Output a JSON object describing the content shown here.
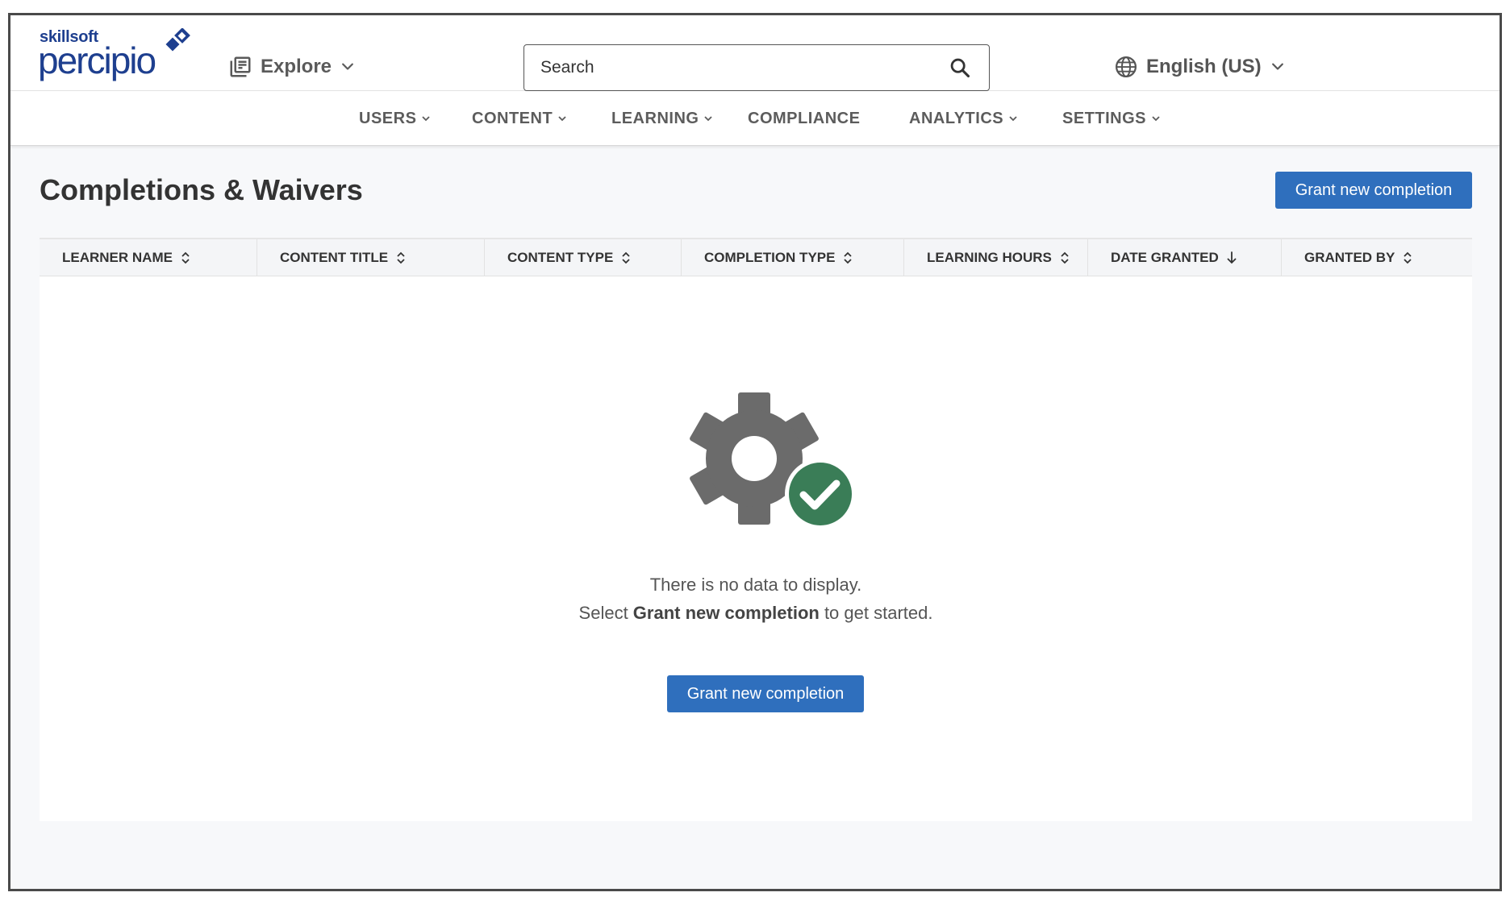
{
  "brand": {
    "top": "skillsoft",
    "main": "percipio",
    "tm": "™",
    "color": "#1e3f8f"
  },
  "header": {
    "explore_label": "Explore",
    "explore_icon": "library-icon",
    "search": {
      "placeholder": "Search",
      "value": "",
      "icon": "search-icon"
    },
    "language": {
      "label": "English (US)",
      "icon": "globe-icon"
    }
  },
  "nav": {
    "items": [
      {
        "label": "USERS",
        "has_menu": true
      },
      {
        "label": "CONTENT",
        "has_menu": true
      },
      {
        "label": "LEARNING",
        "has_menu": true
      },
      {
        "label": "COMPLIANCE",
        "has_menu": false
      },
      {
        "label": "ANALYTICS",
        "has_menu": true
      },
      {
        "label": "SETTINGS",
        "has_menu": true
      }
    ]
  },
  "page": {
    "title": "Completions & Waivers",
    "primary_action": "Grant new completion"
  },
  "table": {
    "columns": [
      {
        "label": "LEARNER NAME",
        "sort": "none"
      },
      {
        "label": "CONTENT TITLE",
        "sort": "none"
      },
      {
        "label": "CONTENT TYPE",
        "sort": "none"
      },
      {
        "label": "COMPLETION TYPE",
        "sort": "none"
      },
      {
        "label": "LEARNING HOURS",
        "sort": "none"
      },
      {
        "label": "DATE GRANTED",
        "sort": "desc"
      },
      {
        "label": "GRANTED BY",
        "sort": "none"
      }
    ],
    "rows": []
  },
  "empty_state": {
    "line1": "There is no data to display.",
    "line2_prefix": "Select ",
    "line2_bold": "Grant new completion",
    "line2_suffix": " to get started.",
    "button_label": "Grant new completion",
    "icon": "gear-check-icon"
  },
  "colors": {
    "accent": "#2f6fbd",
    "success": "#3a7d57",
    "gear": "#6b6b6b"
  }
}
